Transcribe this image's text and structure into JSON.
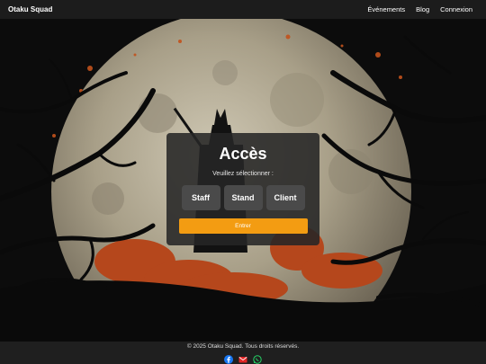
{
  "navbar": {
    "brand": "Otaku Squad",
    "links": [
      "Événements",
      "Blog",
      "Connexion"
    ]
  },
  "card": {
    "title": "Accès",
    "subtitle": "Veuillez sélectionner :",
    "roles": [
      "Staff",
      "Stand",
      "Client"
    ],
    "enter_label": "Entrer"
  },
  "footer": {
    "copyright": "© 2025 Otaku Squad. Tous droits réservés.",
    "social_icons": [
      "facebook-icon",
      "mail-icon",
      "whatsapp-icon"
    ]
  },
  "colors": {
    "accent": "#f39c12",
    "navbar": "#1c1c1c",
    "footer": "#1f1f1f",
    "facebook": "#1877f2",
    "mail": "#e02424",
    "whatsapp": "#25d366"
  }
}
